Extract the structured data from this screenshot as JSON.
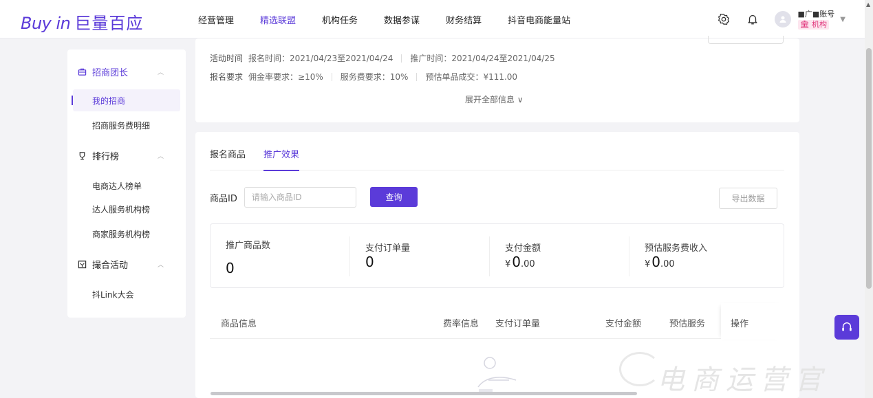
{
  "brand": {
    "logo_latin": "Buy in",
    "logo_cn": "巨量百应",
    "accent": "#5b3bd9"
  },
  "nav": {
    "items": [
      {
        "label": "经营管理",
        "active": false
      },
      {
        "label": "精选联盟",
        "active": true
      },
      {
        "label": "机构任务",
        "active": false
      },
      {
        "label": "数据参谋",
        "active": false
      },
      {
        "label": "财务结算",
        "active": false
      },
      {
        "label": "抖音电商能量站",
        "active": false
      }
    ]
  },
  "account": {
    "name": "■广■账号",
    "tag": "机构"
  },
  "sidebar": {
    "groups": [
      {
        "label": "招商团长",
        "active": true,
        "items": [
          {
            "label": "我的招商",
            "active": true
          },
          {
            "label": "招商服务费明细",
            "active": false
          }
        ]
      },
      {
        "label": "排行榜",
        "active": false,
        "items": [
          {
            "label": "电商达人榜单"
          },
          {
            "label": "达人服务机构榜"
          },
          {
            "label": "商家服务机构榜"
          }
        ]
      },
      {
        "label": "撮合活动",
        "active": false,
        "items": [
          {
            "label": "抖Link大会"
          }
        ]
      }
    ]
  },
  "info": {
    "line1": {
      "key": "活动时间",
      "reg": "报名时间：2021/04/23至2021/04/24",
      "promo": "推广时间：2021/04/24至2021/04/25"
    },
    "line2": {
      "key": "报名要求",
      "commission": "佣金率要求：≥10%",
      "service": "服务费要求：10%",
      "price": "预估单品成交：¥111.00"
    },
    "expand": "展开全部信息 ∨"
  },
  "tabs": [
    {
      "label": "报名商品",
      "active": false
    },
    {
      "label": "推广效果",
      "active": true
    }
  ],
  "filter": {
    "label": "商品ID",
    "placeholder": "请输入商品ID",
    "value": "",
    "query": "查询",
    "export": "导出数据"
  },
  "stats": [
    {
      "label": "推广商品数",
      "currency": "",
      "int": "0",
      "dec": ""
    },
    {
      "label": "支付订单量",
      "currency": "",
      "int": "0",
      "dec": ""
    },
    {
      "label": "支付金额",
      "currency": "¥",
      "int": "0",
      "dec": ".00"
    },
    {
      "label": "预估服务费收入",
      "currency": "¥",
      "int": "0",
      "dec": ".00"
    }
  ],
  "table": {
    "columns": [
      "商品信息",
      "费率信息",
      "支付订单量",
      "支付金额",
      "预估服务",
      "操作"
    ]
  },
  "watermark": "电商运营官"
}
